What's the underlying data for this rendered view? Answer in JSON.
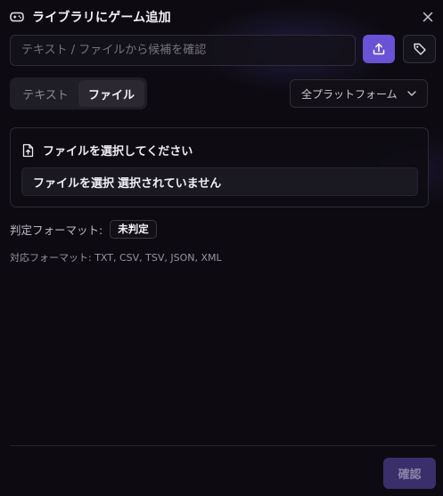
{
  "dialog": {
    "title": "ライブラリにゲーム追加",
    "icon": "gamepad-icon",
    "close_icon": "close-icon"
  },
  "search": {
    "placeholder": "テキスト / ファイルから候補を確認",
    "value": "",
    "upload_icon": "upload-icon",
    "tag_icon": "tag-icon"
  },
  "tabs": [
    {
      "label": "テキスト",
      "active": false
    },
    {
      "label": "ファイル",
      "active": true
    }
  ],
  "platform_select": {
    "value": "全プラットフォーム",
    "icon": "chevron-down-icon"
  },
  "file_section": {
    "title": "ファイルを選択してください",
    "icon": "file-upload-icon",
    "choose_label": "ファイルを選択",
    "status": "選択されていません"
  },
  "format": {
    "label": "判定フォーマット:",
    "value": "未判定",
    "supported": "対応フォーマット: TXT, CSV, TSV, JSON, XML"
  },
  "footer": {
    "confirm_label": "確認"
  },
  "colors": {
    "accent": "#6a52d6",
    "confirm_disabled": "#3a2f6a",
    "background": "#0d0b11"
  }
}
